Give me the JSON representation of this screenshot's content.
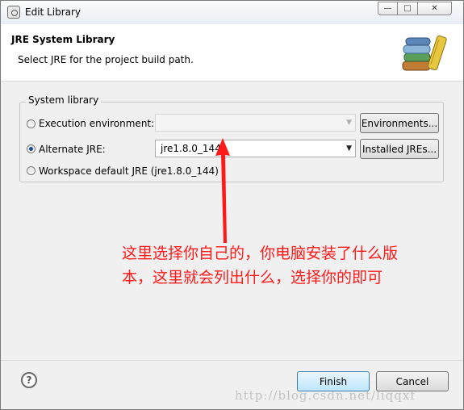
{
  "window": {
    "title": "Edit Library"
  },
  "header": {
    "title": "JRE System Library",
    "description": "Select JRE for the project build path."
  },
  "group": {
    "label": "System library",
    "options": [
      {
        "label": "Execution environment:",
        "selected": false,
        "combo_value": "",
        "button": "Environments..."
      },
      {
        "label": "Alternate JRE:",
        "selected": true,
        "combo_value": "jre1.8.0_144",
        "button": "Installed JREs..."
      },
      {
        "label": "Workspace default JRE (jre1.8.0_144)",
        "selected": false
      }
    ]
  },
  "annotation": {
    "line1": "这里选择你自己的，你电脑安装了什么版",
    "line2": "本，这里就会列出什么，选择你的即可",
    "color": "#ff1a1a"
  },
  "footer": {
    "help": "?",
    "finish": "Finish",
    "cancel": "Cancel"
  },
  "watermark": "http://blog.csdn.net/liqqxf",
  "icons": {
    "window": "eclipse-window-icon",
    "header": "books-library-icon"
  }
}
